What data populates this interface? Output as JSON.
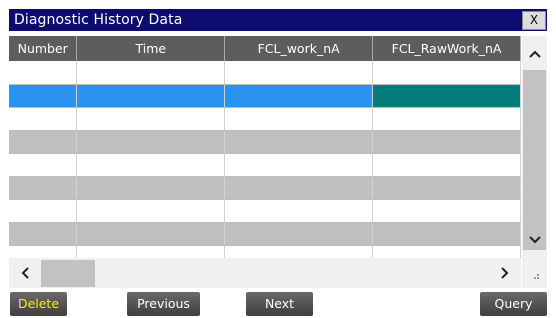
{
  "window": {
    "title": "Diagnostic History Data",
    "close_label": "X"
  },
  "table": {
    "columns": [
      "Number",
      "Time",
      "FCL_work_nA",
      "FCL_RawWork_nA"
    ],
    "rows": [
      {
        "style": "white"
      },
      {
        "style": "selected"
      },
      {
        "style": "white"
      },
      {
        "style": "gray"
      },
      {
        "style": "white"
      },
      {
        "style": "gray"
      },
      {
        "style": "white"
      },
      {
        "style": "gray"
      },
      {
        "style": "white"
      }
    ]
  },
  "colors": {
    "title_bar": "#0c0c70",
    "header": "#5d5d5d",
    "selected_row": "#2a93f0",
    "selected_cell": "#007d7a",
    "alt_row": "#c0c0c0",
    "delete_label": "#f5ec1e"
  },
  "buttons": {
    "delete": "Delete",
    "previous": "Previous",
    "next": "Next",
    "query": "Query"
  },
  "icons": {
    "scroll_up": "chevron-up-icon",
    "scroll_down": "chevron-down-icon",
    "scroll_left": "chevron-left-icon",
    "scroll_right": "chevron-right-icon",
    "size_grip": "resize-grip-icon"
  }
}
